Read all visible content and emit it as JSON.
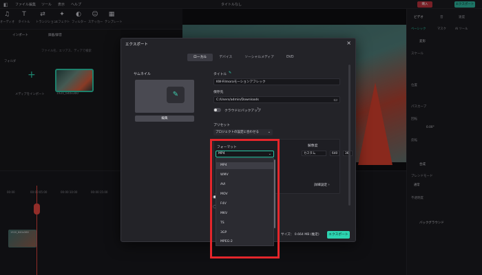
{
  "menubar": {
    "items": [
      "ファイル",
      "編集",
      "ツール",
      "表示",
      "ヘルプ"
    ],
    "title": "タイトルなし",
    "red_button": "購入",
    "green_button": "エクスポート"
  },
  "toolbar": {
    "tools": [
      {
        "label": "オーディオ",
        "icon": "music-icon"
      },
      {
        "label": "タイトル",
        "icon": "title-icon"
      },
      {
        "label": "トランジション",
        "icon": "transition-icon"
      },
      {
        "label": "エフェクト",
        "icon": "effect-icon"
      },
      {
        "label": "フィルター",
        "icon": "filter-icon"
      },
      {
        "label": "ステッカー",
        "icon": "sticker-icon"
      },
      {
        "label": "テンプレート",
        "icon": "template-icon"
      }
    ]
  },
  "media": {
    "import_label": "インポート",
    "record_label": "録画/録音",
    "search_placeholder": "ファイル名、エリアス、ディアで検索",
    "folder_label": "フォルダ",
    "import_tile_label": "メディアをインポート",
    "clip_name": "1920_640x360"
  },
  "right_panel": {
    "tabs": [
      "ビデオ",
      "音",
      "速度"
    ],
    "subtabs": [
      "ベーシック",
      "マスク",
      "AI ツール"
    ],
    "labels": [
      "変形",
      "スケール",
      "位置",
      "パスカーブ",
      "回転",
      "反転",
      "合成",
      "ブレンドモード",
      "不透明度",
      "バックグラウンド"
    ],
    "rotate_value": "0.00°",
    "blend_value": "通常"
  },
  "timeline": {
    "times": [
      "00:00",
      "00:00:05:00",
      "00:00:10:00",
      "00:00:15:00",
      "00:00:20:00",
      "00:00:25:00"
    ],
    "clip_label": "1920_640x360"
  },
  "dialog": {
    "title": "エクスポート",
    "tabs": [
      "ローカル",
      "デバイス",
      "ソーシャルメディア",
      "DVD"
    ],
    "active_tab": 0,
    "thumbnail_label": "サムネイル",
    "edit_label": "編集",
    "title_label": "タイトル",
    "title_value": "KW-Filmoraモーションアフレック",
    "save_label": "保存先",
    "save_value": "C:/Users/admin/Downloads",
    "cloud_label": "クラウドにバックアップ",
    "preset_label": "プリセット",
    "preset_value": "プロジェクトの設定に合わせる",
    "format_label": "フォーマット",
    "format_value": "MP4",
    "resolution_label": "解像度",
    "resolution_value": "カスタム",
    "width": "640",
    "height": "360",
    "advanced_label": "詳細設定",
    "size_text": "サイズ： 0.664 MB (推定)",
    "export_label": "エクスポート"
  },
  "dropdown": {
    "options": [
      "MP4",
      "WMV",
      "AVI",
      "MOV",
      "F4V",
      "MKV",
      "TS",
      "3GP",
      "MPEG-2"
    ],
    "selected": 0
  },
  "colors": {
    "accent": "#2dd3b0",
    "highlight": "#e5262b",
    "danger": "#b8323c"
  }
}
